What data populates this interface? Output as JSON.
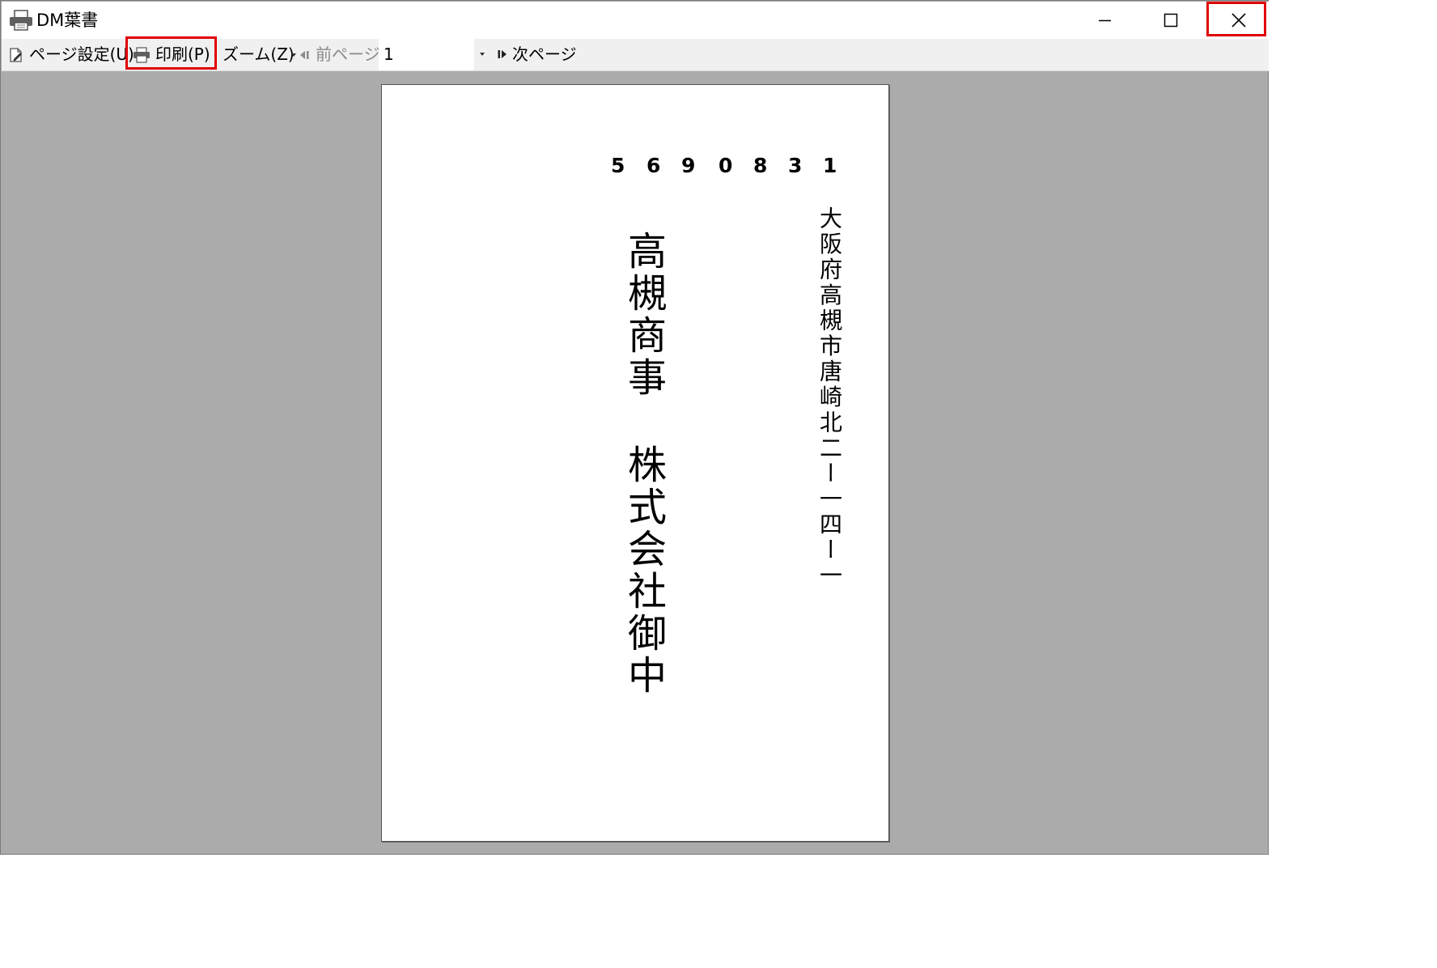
{
  "window": {
    "title": "DM葉書"
  },
  "toolbar": {
    "page_setup": "ページ設定(U)",
    "print": "印刷(P)",
    "zoom": "ズーム(Z)",
    "prev_page": "前ページ",
    "page_number": "1",
    "next_page": "次ページ"
  },
  "postcard": {
    "postal_code_digits": [
      "5",
      "6",
      "9",
      "0",
      "8",
      "3",
      "1"
    ],
    "address": "大阪府高槻市唐崎北二ー一四ー一",
    "company_name": "高槻商事",
    "company_suffix": "株式会社御中"
  },
  "icons": {
    "app": "printer-icon",
    "page_setup": "page-setup-icon",
    "print": "printer-icon",
    "prev": "prev-page-icon",
    "next": "next-page-icon"
  },
  "colors": {
    "highlight": "#e00000",
    "preview_background": "#ababab"
  }
}
